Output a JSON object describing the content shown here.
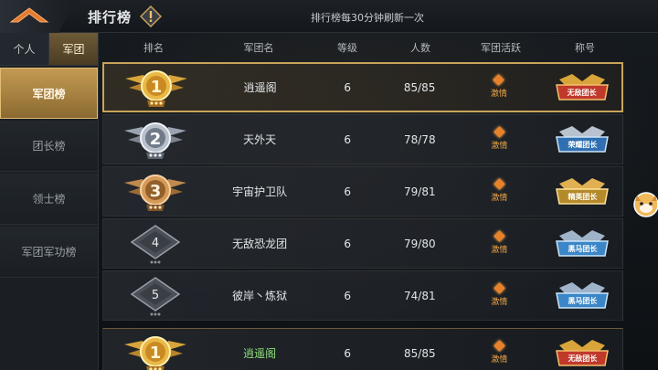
{
  "header": {
    "title": "排行榜",
    "refresh_note": "排行榜每30分钟刷新一次"
  },
  "sidebar": {
    "scope_tabs": [
      {
        "label": "个人",
        "active": false
      },
      {
        "label": "军团",
        "active": true
      }
    ],
    "items": [
      {
        "label": "军团榜",
        "active": true
      },
      {
        "label": "团长榜",
        "active": false
      },
      {
        "label": "领士榜",
        "active": false
      },
      {
        "label": "军团军功榜",
        "active": false
      }
    ]
  },
  "table": {
    "columns": [
      "排名",
      "军团名",
      "等级",
      "人数",
      "军团活跃",
      "称号"
    ],
    "rows": [
      {
        "rank": "1",
        "name": "逍遥阁",
        "level": "6",
        "members": "85/85",
        "activity": "激情",
        "title": "无敌团长",
        "title_color": "red"
      },
      {
        "rank": "2",
        "name": "天外天",
        "level": "6",
        "members": "78/78",
        "activity": "激情",
        "title": "荣耀团长",
        "title_color": "blue"
      },
      {
        "rank": "3",
        "name": "宇宙护卫队",
        "level": "6",
        "members": "79/81",
        "activity": "激情",
        "title": "精英团长",
        "title_color": "gold"
      },
      {
        "rank": "4",
        "name": "无敌恐龙团",
        "level": "6",
        "members": "79/80",
        "activity": "激情",
        "title": "黑马团长",
        "title_color": "blue"
      },
      {
        "rank": "5",
        "name": "彼岸丶炼狱",
        "level": "6",
        "members": "74/81",
        "activity": "激情",
        "title": "黑马团长",
        "title_color": "blue"
      }
    ],
    "self_row": {
      "rank": "1",
      "name": "逍遥阁",
      "level": "6",
      "members": "85/85",
      "activity": "激情",
      "title": "无敌团长",
      "title_color": "red"
    }
  },
  "colors": {
    "accent_gold": "#c9a45a",
    "activity_orange": "#e8822a",
    "self_name_green": "#8fe07c"
  }
}
